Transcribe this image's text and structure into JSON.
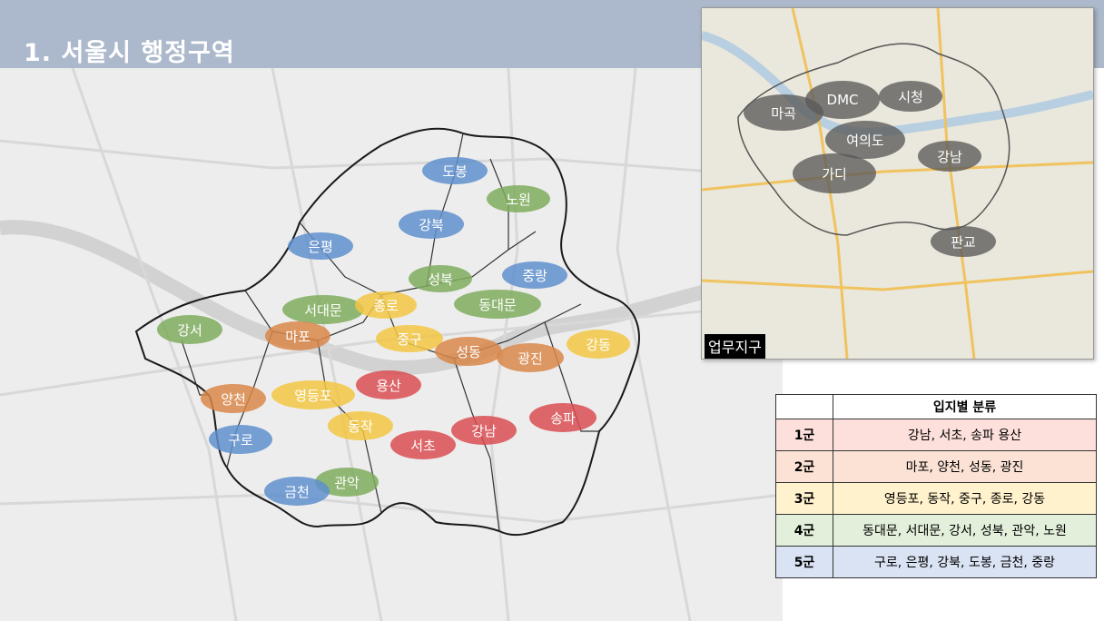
{
  "header": {
    "title": "1. 서울시 행정구역"
  },
  "main_map": {
    "districts": [
      {
        "name": "도봉",
        "color": "#5f8fcc"
      },
      {
        "name": "노원",
        "color": "#7fac5e"
      },
      {
        "name": "강북",
        "color": "#5f8fcc"
      },
      {
        "name": "은평",
        "color": "#5f8fcc"
      },
      {
        "name": "성북",
        "color": "#7fac5e"
      },
      {
        "name": "중랑",
        "color": "#5f8fcc"
      },
      {
        "name": "서대문",
        "color": "#7fac5e"
      },
      {
        "name": "종로",
        "color": "#f2c744"
      },
      {
        "name": "동대문",
        "color": "#7fac5e"
      },
      {
        "name": "강서",
        "color": "#7fac5e"
      },
      {
        "name": "마포",
        "color": "#d9874a"
      },
      {
        "name": "중구",
        "color": "#f2c744"
      },
      {
        "name": "성동",
        "color": "#d9874a"
      },
      {
        "name": "광진",
        "color": "#d9874a"
      },
      {
        "name": "강동",
        "color": "#f2c744"
      },
      {
        "name": "용산",
        "color": "#d94d52"
      },
      {
        "name": "양천",
        "color": "#d9874a"
      },
      {
        "name": "영등포",
        "color": "#f2c744"
      },
      {
        "name": "송파",
        "color": "#d94d52"
      },
      {
        "name": "동작",
        "color": "#f2c744"
      },
      {
        "name": "강남",
        "color": "#d94d52"
      },
      {
        "name": "구로",
        "color": "#5f8fcc"
      },
      {
        "name": "서초",
        "color": "#d94d52"
      },
      {
        "name": "관악",
        "color": "#7fac5e"
      },
      {
        "name": "금천",
        "color": "#5f8fcc"
      }
    ]
  },
  "inset_map": {
    "caption": "업무지구",
    "hubs": [
      "마곡",
      "DMC",
      "시청",
      "여의도",
      "가디",
      "강남",
      "판교"
    ]
  },
  "legend": {
    "header": "입지별 분류",
    "rows": [
      {
        "tier": "1군",
        "districts": "강남, 서초, 송파 용산",
        "color": "#fde0dc"
      },
      {
        "tier": "2군",
        "districts": "마포, 양천, 성동, 광진",
        "color": "#fbe2d5"
      },
      {
        "tier": "3군",
        "districts": "영등포, 동작, 중구, 종로, 강동",
        "color": "#fff2cc"
      },
      {
        "tier": "4군",
        "districts": "동대문, 서대문,  강서, 성북, 관악, 노원",
        "color": "#e2efda"
      },
      {
        "tier": "5군",
        "districts": "구로, 은평, 강북, 도봉, 금천, 중랑",
        "color": "#dae3f3"
      }
    ]
  }
}
